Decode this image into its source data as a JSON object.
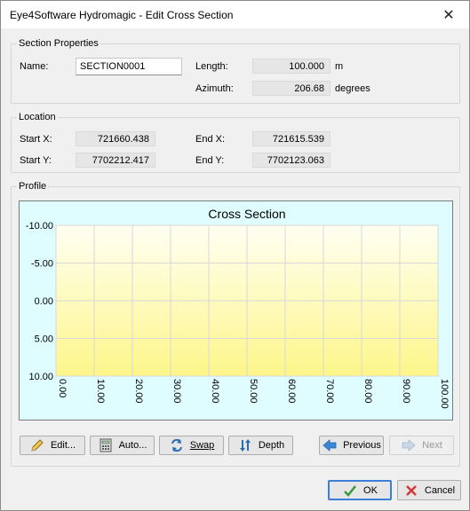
{
  "window": {
    "title": "Eye4Software Hydromagic - Edit Cross Section",
    "close_symbol": "✕"
  },
  "section_properties": {
    "group_label": "Section Properties",
    "name_label": "Name:",
    "name_value": "SECTION0001",
    "length_label": "Length:",
    "length_value": "100.000",
    "length_unit": "m",
    "azimuth_label": "Azimuth:",
    "azimuth_value": "206.68",
    "azimuth_unit": "degrees"
  },
  "location": {
    "group_label": "Location",
    "start_x_label": "Start X:",
    "start_x_value": "721660.438",
    "end_x_label": "End X:",
    "end_x_value": "721615.539",
    "start_y_label": "Start Y:",
    "start_y_value": "7702212.417",
    "end_y_label": "End Y:",
    "end_y_value": "7702123.063"
  },
  "profile": {
    "group_label": "Profile"
  },
  "chart_data": {
    "type": "line",
    "title": "Cross Section",
    "xlabel": "",
    "ylabel": "",
    "x_ticks": [
      "0.00",
      "10.00",
      "20.00",
      "30.00",
      "40.00",
      "50.00",
      "60.00",
      "70.00",
      "80.00",
      "90.00",
      "100.00"
    ],
    "y_ticks": [
      "-10.00",
      "-5.00",
      "0.00",
      "5.00",
      "10.00"
    ],
    "xlim": [
      0,
      100
    ],
    "ylim": [
      -10,
      10
    ],
    "y_inverted": true,
    "grid": true,
    "series": [],
    "colors": {
      "frame_bg": "#dffcff",
      "plot_top": "#fffff2",
      "plot_bottom": "#fdf68a",
      "grid": "#d8d8d8"
    }
  },
  "buttons": {
    "edit": {
      "label": "Edit...",
      "icon": "pencil-icon"
    },
    "auto": {
      "label": "Auto...",
      "icon": "calculator-icon"
    },
    "swap": {
      "label": "Swap",
      "icon": "swap-arrows-icon"
    },
    "depth": {
      "label": "Depth",
      "icon": "depth-arrows-icon"
    },
    "previous": {
      "label": "Previous",
      "icon": "arrow-left-icon"
    },
    "next": {
      "label": "Next",
      "icon": "arrow-right-icon",
      "disabled": true
    },
    "ok": {
      "label": "OK",
      "icon": "checkmark-icon"
    },
    "cancel": {
      "label": "Cancel",
      "icon": "red-x-icon"
    }
  }
}
